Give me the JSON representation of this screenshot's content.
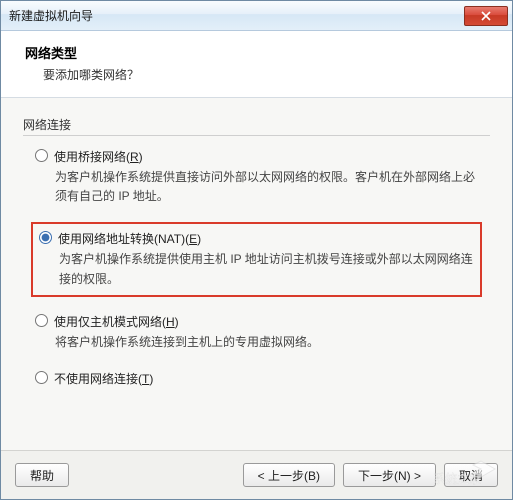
{
  "window": {
    "title": "新建虚拟机向导"
  },
  "header": {
    "title": "网络类型",
    "description": "要添加哪类网络？"
  },
  "group": {
    "label": "网络连接"
  },
  "options": {
    "bridged": {
      "label_prefix": "使用桥接网络(",
      "shortcut": "R",
      "label_suffix": ")",
      "description": "为客户机操作系统提供直接访问外部以太网网络的权限。客户机在外部网络上必须有自己的 IP 地址。"
    },
    "nat": {
      "label_prefix": "使用网络地址转换(NAT)(",
      "shortcut": "E",
      "label_suffix": ")",
      "description": "为客户机操作系统提供使用主机 IP 地址访问主机拨号连接或外部以太网网络连接的权限。"
    },
    "hostonly": {
      "label_prefix": "使用仅主机模式网络(",
      "shortcut": "H",
      "label_suffix": ")",
      "description": "将客户机操作系统连接到主机上的专用虚拟网络。"
    },
    "none": {
      "label_prefix": "不使用网络连接(",
      "shortcut": "T",
      "label_suffix": ")"
    }
  },
  "buttons": {
    "help": "帮助",
    "back": "< 上一步(B)",
    "next": "下一步(N) >",
    "cancel": "取消"
  }
}
